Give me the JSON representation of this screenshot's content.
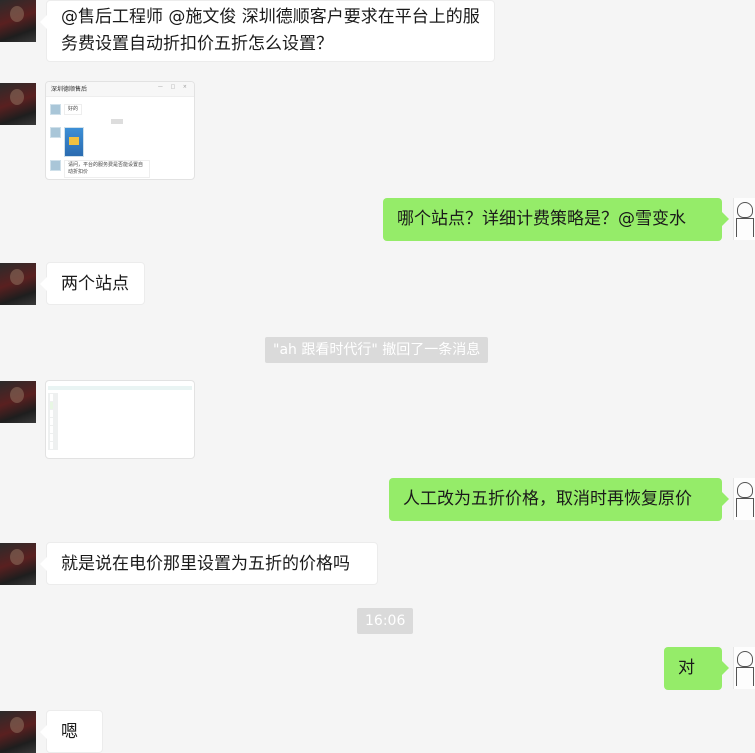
{
  "messages": {
    "m1": "@售后工程师 @施文俊    深圳德顺客户要求在平台上的服务费设置自动折扣价五折怎么设置？",
    "m2": "哪个站点？详细计费策略是？@雪变水",
    "m3": "两个站点",
    "m4": "人工改为五折价格，取消时再恢复原价",
    "m5": "就是说在电价那里设置为五折的价格吗",
    "m6": "对",
    "m7": "嗯"
  },
  "system": {
    "recall": "\"ah 跟看时代行\" 撤回了一条消息",
    "time": "16:06"
  },
  "thumb1": {
    "title": "深圳德顺售后",
    "line1": "好的",
    "line2": "请问，平台的服务费是否能设置自动折扣价"
  },
  "colors": {
    "outgoing_bubble": "#95ec69",
    "incoming_bubble": "#ffffff",
    "background": "#f5f5f5",
    "system_notice": "#dadada"
  }
}
